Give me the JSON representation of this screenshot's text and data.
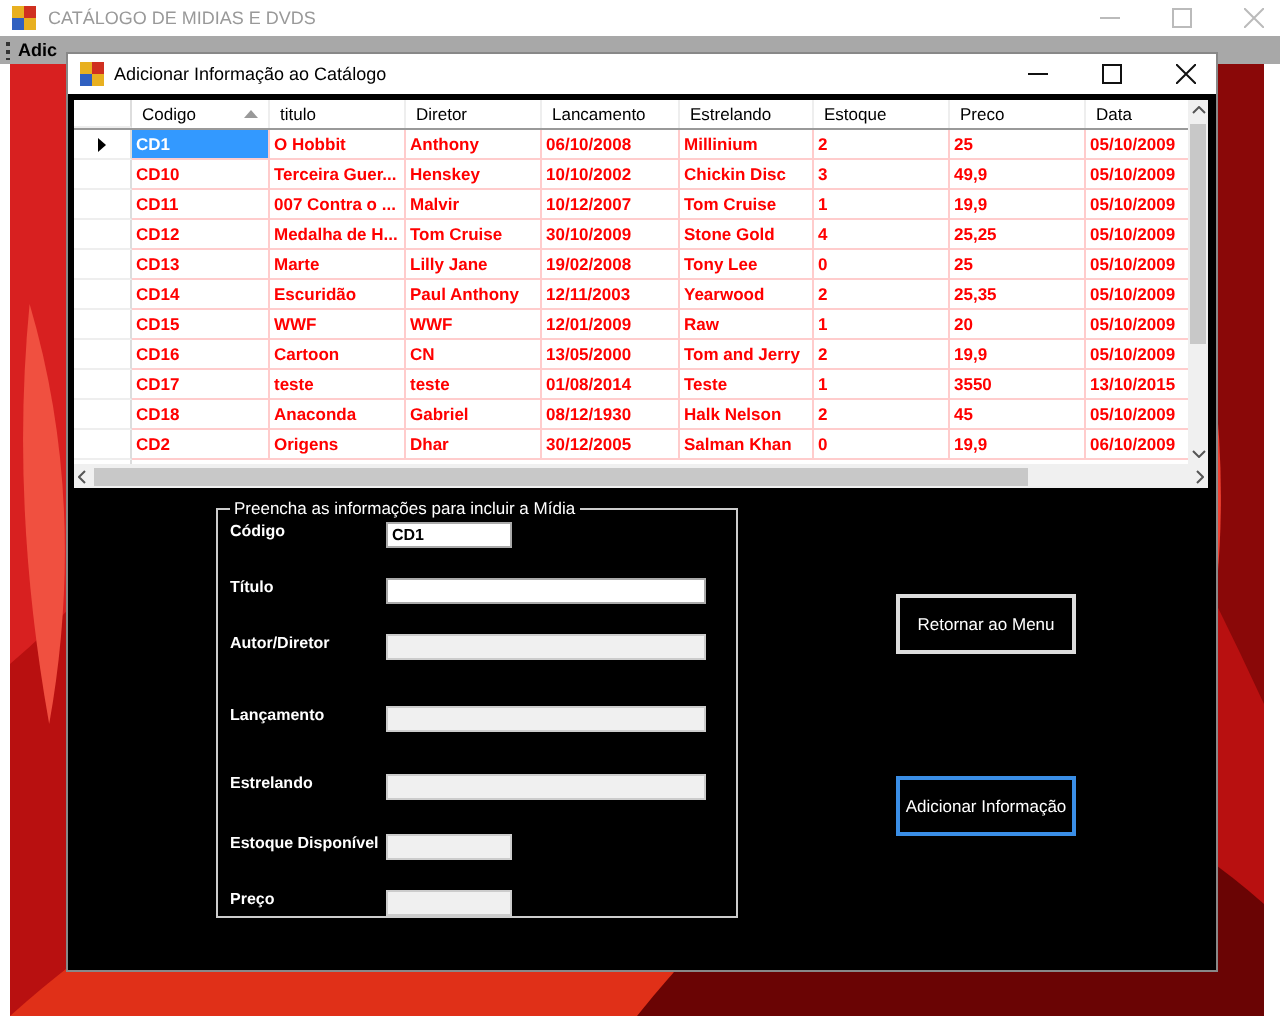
{
  "window": {
    "title": "CATÁLOGO DE MIDIAS E DVDS"
  },
  "menu": {
    "items": [
      "Adic"
    ]
  },
  "dialog": {
    "title": "Adicionar Informação ao Catálogo",
    "grid": {
      "columns": [
        {
          "label": "Codigo",
          "sorted": true
        },
        {
          "label": "titulo",
          "sorted": false
        },
        {
          "label": "Diretor",
          "sorted": false
        },
        {
          "label": "Lancamento",
          "sorted": false
        },
        {
          "label": "Estrelando",
          "sorted": false
        },
        {
          "label": "Estoque",
          "sorted": false
        },
        {
          "label": "Preco",
          "sorted": false
        },
        {
          "label": "Data",
          "sorted": false
        }
      ],
      "rows": [
        {
          "selected": true,
          "cells": [
            "CD1",
            "O Hobbit",
            "Anthony",
            "06/10/2008",
            "Millinium",
            "2",
            "25",
            "05/10/2009"
          ]
        },
        {
          "selected": false,
          "cells": [
            "CD10",
            "Terceira Guer...",
            "Henskey",
            "10/10/2002",
            "Chickin Disc",
            "3",
            "49,9",
            "05/10/2009"
          ]
        },
        {
          "selected": false,
          "cells": [
            "CD11",
            "007 Contra o ...",
            "Malvir",
            "10/12/2007",
            "Tom Cruise",
            "1",
            "19,9",
            "05/10/2009"
          ]
        },
        {
          "selected": false,
          "cells": [
            "CD12",
            "Medalha de H...",
            "Tom Cruise",
            "30/10/2009",
            "Stone Gold",
            "4",
            "25,25",
            "05/10/2009"
          ]
        },
        {
          "selected": false,
          "cells": [
            "CD13",
            "Marte",
            "Lilly Jane",
            "19/02/2008",
            "Tony Lee",
            "0",
            "25",
            "05/10/2009"
          ]
        },
        {
          "selected": false,
          "cells": [
            "CD14",
            "Escuridão",
            "Paul Anthony",
            "12/11/2003",
            "Yearwood",
            "2",
            "25,35",
            "05/10/2009"
          ]
        },
        {
          "selected": false,
          "cells": [
            "CD15",
            "WWF",
            "WWF",
            "12/01/2009",
            "Raw",
            "1",
            "20",
            "05/10/2009"
          ]
        },
        {
          "selected": false,
          "cells": [
            "CD16",
            "Cartoon",
            "CN",
            "13/05/2000",
            "Tom and Jerry",
            "2",
            "19,9",
            "05/10/2009"
          ]
        },
        {
          "selected": false,
          "cells": [
            "CD17",
            "teste",
            "teste",
            "01/08/2014",
            "Teste",
            "1",
            "3550",
            "13/10/2015"
          ]
        },
        {
          "selected": false,
          "cells": [
            "CD18",
            "Anaconda",
            "Gabriel",
            "08/12/1930",
            "Halk Nelson",
            "2",
            "45",
            "05/10/2009"
          ]
        },
        {
          "selected": false,
          "cells": [
            "CD2",
            "Origens",
            "Dhar",
            "30/12/2005",
            "Salman Khan",
            "0",
            "19,9",
            "06/10/2009"
          ]
        }
      ]
    },
    "form": {
      "legend": "Preencha as informações para incluir a Mídia",
      "fields": [
        {
          "label": "Código",
          "value": "CD1",
          "disabled": false,
          "kind": "short"
        },
        {
          "label": "Título",
          "disabled": false,
          "kind": "long"
        },
        {
          "label": "Autor/Diretor",
          "disabled": true,
          "kind": "long"
        },
        {
          "label": "Lançamento",
          "disabled": true,
          "kind": "long"
        },
        {
          "label": "Estrelando",
          "disabled": true,
          "kind": "long"
        },
        {
          "label": "Estoque Disponível",
          "disabled": true,
          "kind": "short"
        },
        {
          "label": "Preço",
          "disabled": true,
          "kind": "short"
        }
      ]
    },
    "buttons": [
      {
        "label": "Retornar ao Menu",
        "focused": false
      },
      {
        "label": "Adicionar Informação",
        "focused": true
      }
    ]
  }
}
